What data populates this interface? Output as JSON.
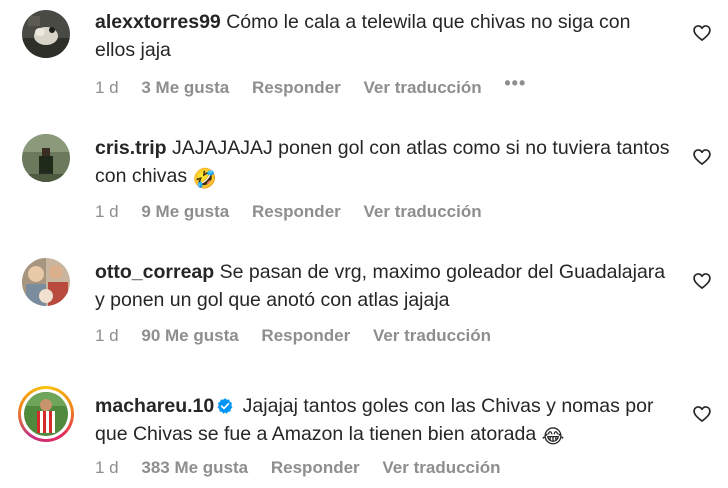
{
  "comments": [
    {
      "username": "alexxtorres99",
      "verified": false,
      "text": "Cómo le cala a telewila que chivas no siga con ellos jaja",
      "emoji": "",
      "time": "1 d",
      "likes": "3 Me gusta",
      "reply": "Responder",
      "translate": "Ver traducción",
      "more": "•••"
    },
    {
      "username": "cris.trip",
      "verified": false,
      "text": "JAJAJAJAJ ponen gol con atlas como si no tuviera tantos con chivas",
      "emoji": "🤣",
      "time": "1 d",
      "likes": "9 Me gusta",
      "reply": "Responder",
      "translate": "Ver traducción",
      "more": ""
    },
    {
      "username": "otto_correap",
      "verified": false,
      "text": "Se pasan de vrg, maximo goleador del Guadalajara y ponen un gol que anotó con atlas jajaja",
      "emoji": "",
      "time": "1 d",
      "likes": "90 Me gusta",
      "reply": "Responder",
      "translate": "Ver traducción",
      "more": ""
    },
    {
      "username": "machareu.10",
      "verified": true,
      "text": "Jajajaj tantos goles con las Chivas y nomas por que Chivas se fue a Amazon la tienen bien atorada",
      "emoji": "😂",
      "time": "1 d",
      "likes": "383 Me gusta",
      "reply": "Responder",
      "translate": "Ver traducción",
      "more": ""
    }
  ],
  "colors": {
    "text": "#262626",
    "secondary": "#8e8e8e",
    "verified": "#0095f6"
  },
  "icons": {
    "like": "heart-outline-icon",
    "verified": "verified-badge-icon",
    "more": "more-options-icon"
  }
}
